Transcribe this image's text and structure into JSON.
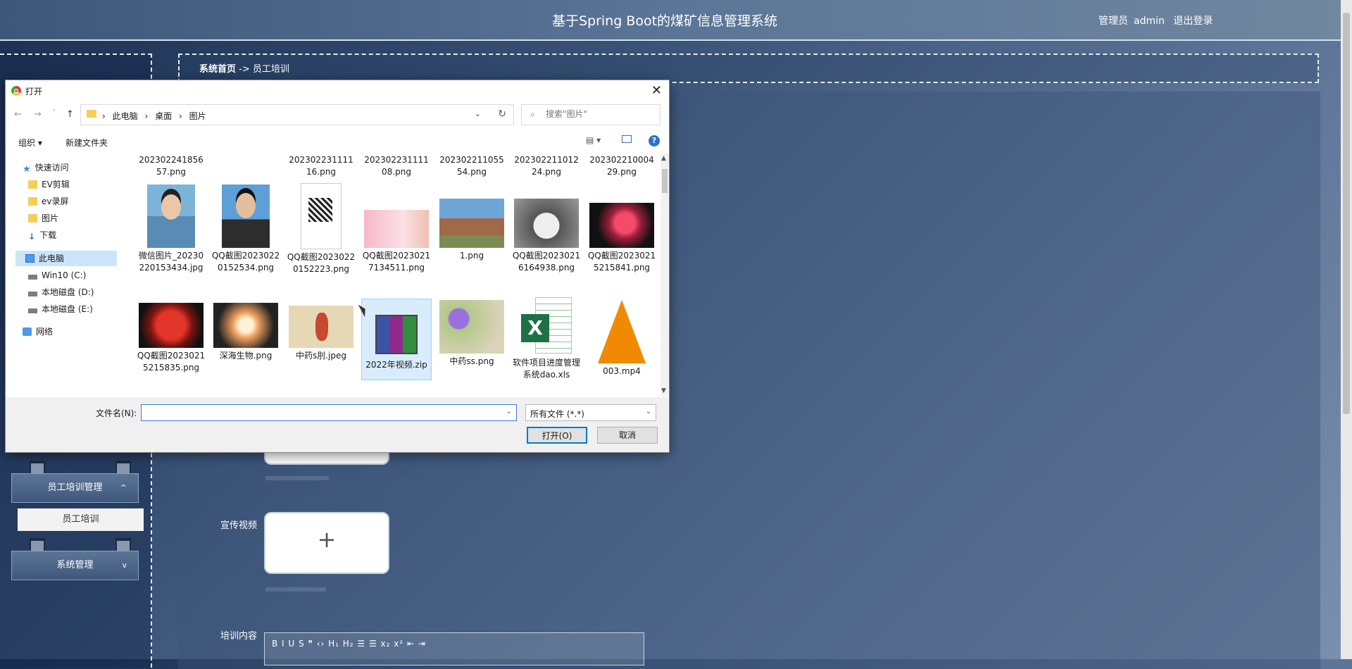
{
  "header": {
    "title": "基于Spring Boot的煤矿信息管理系统",
    "user_role": "管理员",
    "username": "admin",
    "logout": "退出登录"
  },
  "breadcrumb": {
    "home": "系统首页",
    "sep": "->",
    "current": "员工培训"
  },
  "sidebar": {
    "groups": [
      {
        "label": "员工培训管理",
        "chevron": "^",
        "expanded": true
      },
      {
        "label": "系统管理",
        "chevron": "v",
        "expanded": false
      }
    ],
    "active_item": "员工培训"
  },
  "form": {
    "video_label": "宣传视频",
    "upload_symbol": "+",
    "content_label": "培训内容",
    "editor_tools": "B  I  U  S   ❞  ‹›   H₁  H₂   ☰  ☰   x₂  x²   ⇤  ⇥"
  },
  "dialog": {
    "title": "打开",
    "close": "✕",
    "nav": {
      "back": "←",
      "forward": "→",
      "recent": "˅",
      "up": "↑"
    },
    "address": [
      "此电脑",
      "桌面",
      "图片"
    ],
    "address_sep": "›",
    "search_placeholder": "搜索\"图片\"",
    "toolbar": {
      "organize": "组织 ▾",
      "new_folder": "新建文件夹",
      "view": "▤ ▾",
      "help": "?"
    },
    "tree": [
      {
        "label": "快速访问",
        "icon": "star-icon"
      },
      {
        "label": "EV剪辑",
        "icon": "folder-icon"
      },
      {
        "label": "ev录屏",
        "icon": "folder-icon"
      },
      {
        "label": "图片",
        "icon": "folder-icon"
      },
      {
        "label": "下载",
        "icon": "download-icon"
      },
      {
        "label": "此电脑",
        "icon": "computer-icon",
        "selected": true
      },
      {
        "label": "Win10 (C:)",
        "icon": "drive-icon"
      },
      {
        "label": "本地磁盘 (D:)",
        "icon": "drive-icon"
      },
      {
        "label": "本地磁盘 (E:)",
        "icon": "drive-icon"
      },
      {
        "label": "网络",
        "icon": "network-icon"
      }
    ],
    "files_row0": [
      "20230224185657.png",
      "",
      "20230223111116.png",
      "20230223111108.png",
      "20230221105554.png",
      "20230221101224.png",
      "20230221000429.png"
    ],
    "files_row1": [
      {
        "name": "微信图片_20230220153434.jpg",
        "thumb": "photo-woman"
      },
      {
        "name": "QQ截图20230220152534.png",
        "thumb": "photo-man"
      },
      {
        "name": "QQ截图20230220152223.png",
        "thumb": "qr-doc"
      },
      {
        "name": "QQ截图20230217134511.png",
        "thumb": "pink-banner"
      },
      {
        "name": "1.png",
        "thumb": "city"
      },
      {
        "name": "QQ截图20230216164938.png",
        "thumb": "motorbike"
      },
      {
        "name": "QQ截图20230215215841.png",
        "thumb": "jellyfish"
      }
    ],
    "files_row2": [
      {
        "name": "QQ截图20230215215835.png",
        "thumb": "red-creature"
      },
      {
        "name": "深海生物.png",
        "thumb": "sea-urchin"
      },
      {
        "name": "中药s刖.jpeg",
        "thumb": "herb-card"
      },
      {
        "name": "2022年视频.zip",
        "thumb": "winrar-zip",
        "selected": true
      },
      {
        "name": "中药ss.png",
        "thumb": "flower"
      },
      {
        "name": "软件项目进度管理系统dao.xls",
        "thumb": "excel"
      },
      {
        "name": "003.mp4",
        "thumb": "vlc-cone"
      }
    ],
    "filename_label": "文件名(N):",
    "filename_value": "",
    "filetype": "所有文件 (*.*)",
    "open_button": "打开(O)",
    "cancel_button": "取消"
  }
}
